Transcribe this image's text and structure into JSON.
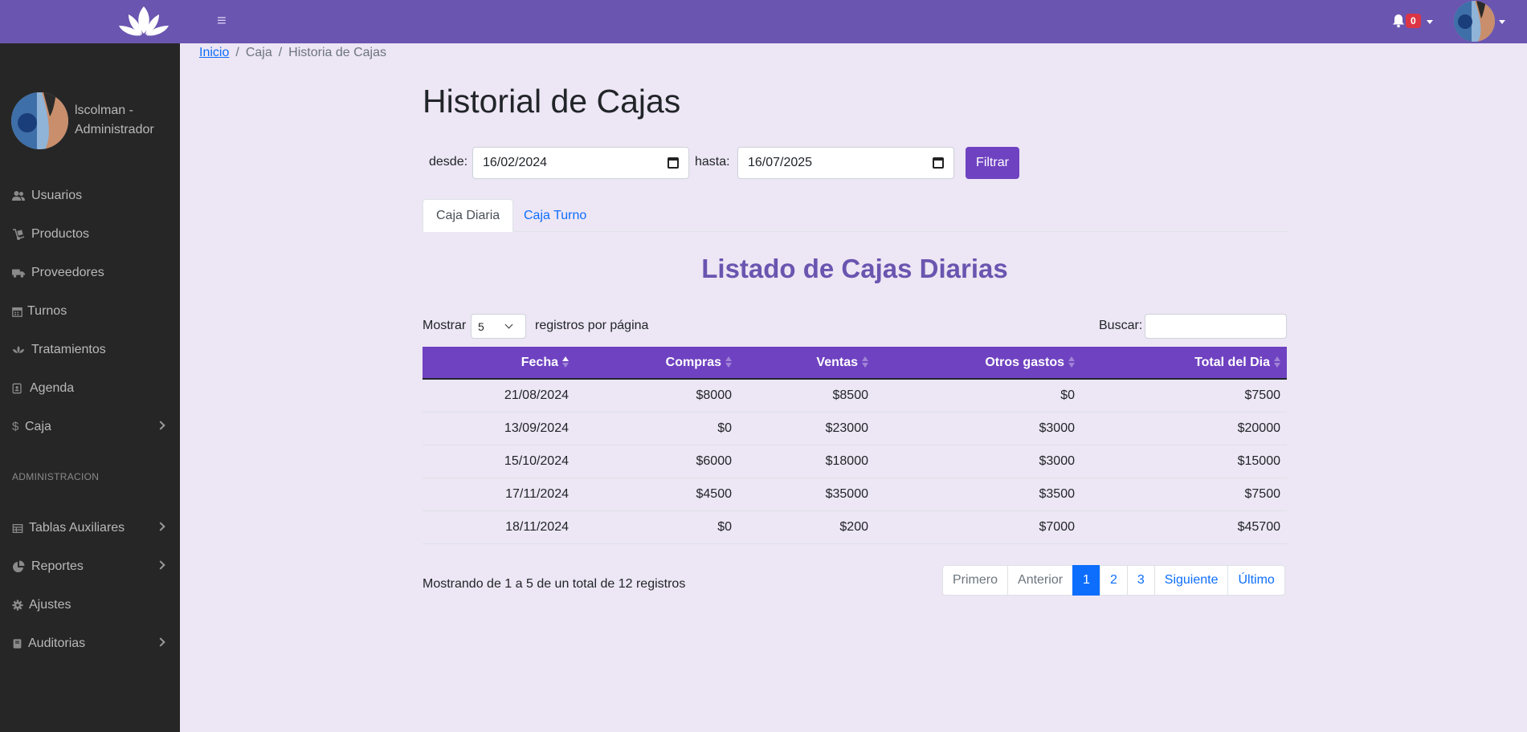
{
  "header": {
    "menu_icon": "hamburger-icon",
    "notifications_count": "0"
  },
  "sidebar": {
    "user_name": "lscolman - Administrador",
    "items": [
      {
        "label": "Usuarios",
        "icon": "users-icon"
      },
      {
        "label": "Productos",
        "icon": "dolly-icon"
      },
      {
        "label": "Proveedores",
        "icon": "truck-icon"
      },
      {
        "label": "Turnos",
        "icon": "calendar-icon"
      },
      {
        "label": "Tratamientos",
        "icon": "spa-icon"
      },
      {
        "label": "Agenda",
        "icon": "address-book-icon"
      },
      {
        "label": "Caja",
        "icon": "dollar-icon"
      }
    ],
    "section_header": "ADMINISTRACION",
    "admin_items": [
      {
        "label": "Tablas Auxiliares",
        "icon": "table-icon"
      },
      {
        "label": "Reportes",
        "icon": "chart-pie-icon"
      },
      {
        "label": "Ajustes",
        "icon": "cog-icon"
      },
      {
        "label": "Auditorias",
        "icon": "book-icon"
      }
    ]
  },
  "breadcrumb": {
    "home": "Inicio",
    "level1": "Caja",
    "current": "Historia de Cajas",
    "separator": "/"
  },
  "page": {
    "title": "Historial de Cajas"
  },
  "filter": {
    "from_label": "desde:",
    "from_value": "16/02/2024",
    "to_label": "hasta:",
    "to_value": "16/07/2025",
    "button": "Filtrar"
  },
  "tabs": [
    {
      "label": "Caja Diaria",
      "active": true
    },
    {
      "label": "Caja Turno",
      "active": false
    }
  ],
  "list": {
    "title": "Listado de Cajas Diarias",
    "show_label": "Mostrar",
    "page_size": "5",
    "per_page_label": "registros por página",
    "search_label": "Buscar:",
    "search_value": ""
  },
  "table": {
    "columns": [
      "Fecha",
      "Compras",
      "Ventas",
      "Otros gastos",
      "Total del Dia"
    ],
    "rows": [
      [
        "21/08/2024",
        "$8000",
        "$8500",
        "$0",
        "$7500"
      ],
      [
        "13/09/2024",
        "$0",
        "$23000",
        "$3000",
        "$20000"
      ],
      [
        "15/10/2024",
        "$6000",
        "$18000",
        "$3000",
        "$15000"
      ],
      [
        "17/11/2024",
        "$4500",
        "$35000",
        "$3500",
        "$7500"
      ],
      [
        "18/11/2024",
        "$0",
        "$200",
        "$7000",
        "$45700"
      ]
    ]
  },
  "footer": {
    "info": "Mostrando de 1 a 5 de un total de 12 registros",
    "pagination": {
      "first": "Primero",
      "prev": "Anterior",
      "pages": [
        "1",
        "2",
        "3"
      ],
      "current": "1",
      "next": "Siguiente",
      "last": "Último"
    }
  },
  "colors": {
    "topbar": "#6a55b0",
    "sidebar": "#262626",
    "accent": "#6f42c1",
    "link": "#0d6efd",
    "badge": "#dc3545"
  }
}
